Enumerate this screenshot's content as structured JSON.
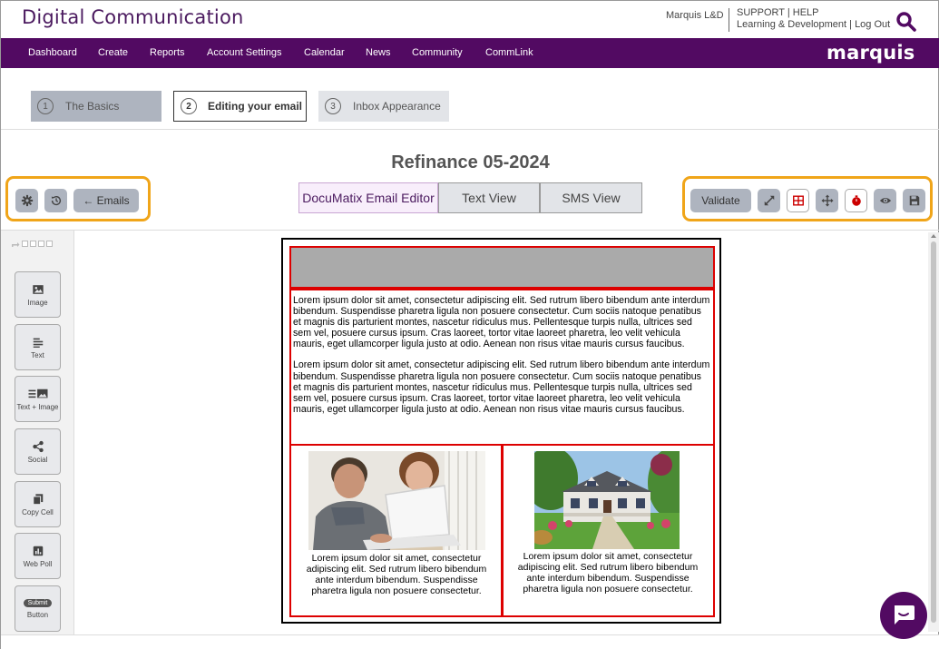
{
  "header": {
    "app_title": "Digital Communication",
    "user": "Marquis L&D",
    "support": "SUPPORT",
    "help": "HELP",
    "learning": "Learning & Development",
    "logout": "Log Out",
    "brand": "marquis"
  },
  "nav": {
    "items": [
      "Dashboard",
      "Create",
      "Reports",
      "Account Settings",
      "Calendar",
      "News",
      "Community",
      "CommLink"
    ]
  },
  "steps": [
    {
      "num": "1",
      "label": "The Basics"
    },
    {
      "num": "2",
      "label": "Editing your email"
    },
    {
      "num": "3",
      "label": "Inbox Appearance"
    }
  ],
  "email": {
    "title": "Refinance 05-2024"
  },
  "toolbar": {
    "emails_label": "← Emails",
    "validate_label": "Validate"
  },
  "views": [
    "DocuMatix Email Editor",
    "Text View",
    "SMS View"
  ],
  "widgets": [
    "Image",
    "Text",
    "Text + Image",
    "Social",
    "Copy Cell",
    "Web Poll",
    "Button"
  ],
  "widget_button_pill": "Submit",
  "content": {
    "para1": "Lorem ipsum dolor sit amet, consectetur adipiscing elit. Sed rutrum libero bibendum ante interdum bibendum. Suspendisse pharetra ligula non posuere consectetur. Cum sociis natoque penatibus et magnis dis parturient montes, nascetur ridiculus mus. Pellentesque turpis nulla, ultrices sed sem vel, posuere cursus ipsum. Cras laoreet, tortor vitae laoreet pharetra, leo velit vehicula mauris, eget ullamcorper ligula justo at odio. Aenean non risus vitae mauris cursus faucibus.",
    "para2": "Lorem ipsum dolor sit amet, consectetur adipiscing elit. Sed rutrum libero bibendum ante interdum bibendum. Suspendisse pharetra ligula non posuere consectetur. Cum sociis natoque penatibus et magnis dis parturient montes, nascetur ridiculus mus. Pellentesque turpis nulla, ultrices sed sem vel, posuere cursus ipsum. Cras laoreet, tortor vitae laoreet pharetra, leo velit vehicula mauris, eget ullamcorper ligula justo at odio. Aenean non risus vitae mauris cursus faucibus.",
    "col_left": "Lorem ipsum dolor sit amet, consectetur adipiscing elit. Sed rutrum libero bibendum ante interdum bibendum. Suspendisse pharetra ligula non posuere consectetur.",
    "col_right": "Lorem ipsum dolor sit amet, consectetur adipiscing elit. Sed rutrum libero bibendum ante interdum bibendum. Suspendisse pharetra ligula non posuere consectetur."
  },
  "colors": {
    "brand_purple": "#520a62",
    "highlight_orange": "#f0a519",
    "cell_border_red": "#dd0000"
  }
}
